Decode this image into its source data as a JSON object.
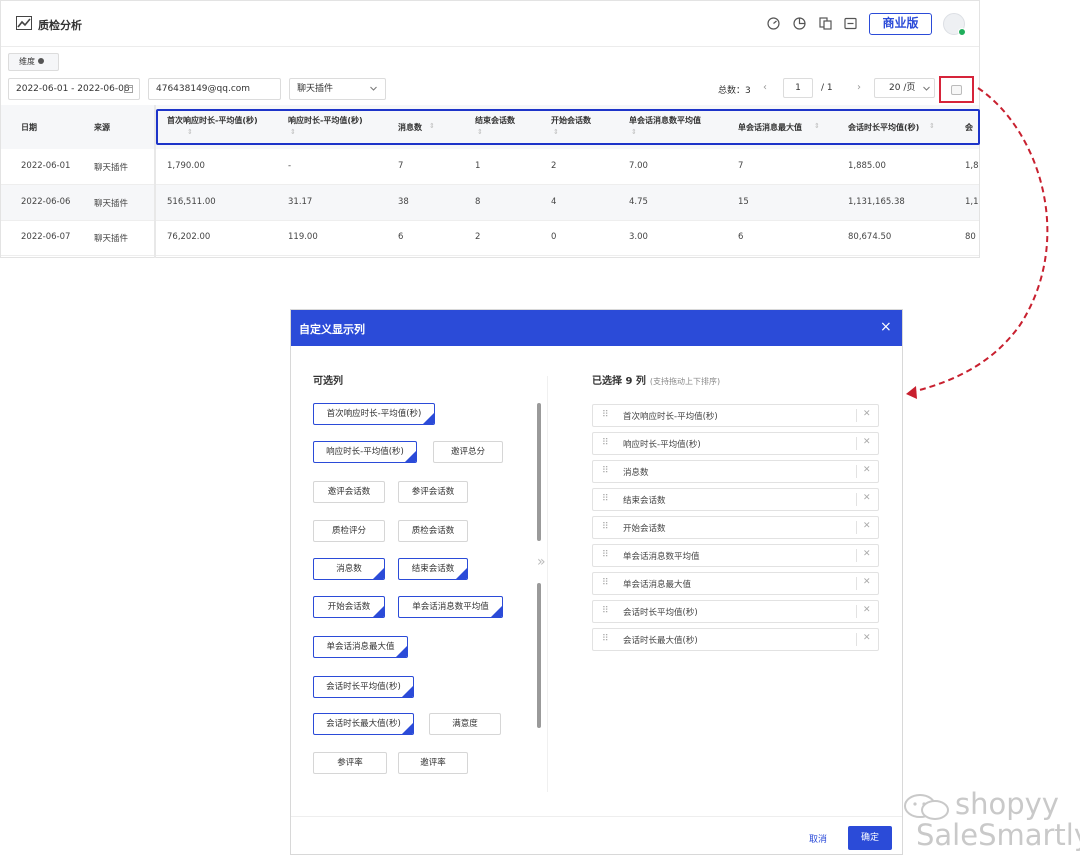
{
  "app": {
    "title": "质检分析",
    "business_label": "商业版"
  },
  "filters": {
    "dimension_tab": "维度",
    "date_range": "2022-06-01 - 2022-06-08",
    "email": "476438149@qq.com",
    "channel": "聊天插件"
  },
  "pager": {
    "total": "总数：3",
    "prev": "‹",
    "page": "1",
    "of": "/  1",
    "next": "›",
    "page_size": "20 /页"
  },
  "table": {
    "fixed_headers": [
      "日期",
      "来源"
    ],
    "headers": [
      "首次响应时长-平均值(秒)",
      "响应时长-平均值(秒)",
      "消息数",
      "结束会话数",
      "开始会话数",
      "单会话消息数平均值",
      "单会话消息最大值",
      "会话时长平均值(秒)",
      "会"
    ],
    "rows": [
      {
        "date": "2022-06-01",
        "source": "聊天插件",
        "cells": [
          "1,790.00",
          "-",
          "7",
          "1",
          "2",
          "7.00",
          "7",
          "1,885.00",
          "1,8"
        ]
      },
      {
        "date": "2022-06-06",
        "source": "聊天插件",
        "cells": [
          "516,511.00",
          "31.17",
          "38",
          "8",
          "4",
          "4.75",
          "15",
          "1,131,165.38",
          "1,1"
        ]
      },
      {
        "date": "2022-06-07",
        "source": "聊天插件",
        "cells": [
          "76,202.00",
          "119.00",
          "6",
          "2",
          "0",
          "3.00",
          "6",
          "80,674.50",
          "80"
        ]
      }
    ]
  },
  "modal": {
    "title": "自定义显示列",
    "close": "×",
    "available_title": "可选列",
    "selected_title": "已选择 9 列",
    "selected_hint": "(支持拖动上下排序)",
    "transfer": "»",
    "available": [
      {
        "label": "首次响应时长-平均值(秒)",
        "selected": true
      },
      {
        "label": "响应时长-平均值(秒)",
        "selected": true
      },
      {
        "label": "邀评总分",
        "selected": false
      },
      {
        "label": "邀评会话数",
        "selected": false
      },
      {
        "label": "参评会话数",
        "selected": false
      },
      {
        "label": "质检评分",
        "selected": false
      },
      {
        "label": "质检会话数",
        "selected": false
      },
      {
        "label": "消息数",
        "selected": true
      },
      {
        "label": "结束会话数",
        "selected": true
      },
      {
        "label": "开始会话数",
        "selected": true
      },
      {
        "label": "单会话消息数平均值",
        "selected": true
      },
      {
        "label": "单会话消息最大值",
        "selected": true
      },
      {
        "label": "会话时长平均值(秒)",
        "selected": true
      },
      {
        "label": "会话时长最大值(秒)",
        "selected": true
      },
      {
        "label": "满意度",
        "selected": false
      },
      {
        "label": "参评率",
        "selected": false
      },
      {
        "label": "邀评率",
        "selected": false
      }
    ],
    "selected": [
      "首次响应时长-平均值(秒)",
      "响应时长-平均值(秒)",
      "消息数",
      "结束会话数",
      "开始会话数",
      "单会话消息数平均值",
      "单会话消息最大值",
      "会话时长平均值(秒)",
      "会话时长最大值(秒)"
    ],
    "cancel": "取消",
    "ok": "确定"
  },
  "watermark": {
    "line1": "shopyy",
    "line2": "SaleSmartly"
  },
  "colors": {
    "primary": "#2b4bd8",
    "highlight_box": "#1d34c9",
    "annotation_red": "#d6243a",
    "online": "#1fae5b"
  },
  "icons": {
    "logo": "chart-line-icon",
    "toolbar": [
      "speedometer-icon",
      "pie-chart-icon",
      "copy-icon",
      "export-icon"
    ],
    "row_handle": "drag-handle-icon",
    "row_remove": "remove-x-icon"
  }
}
